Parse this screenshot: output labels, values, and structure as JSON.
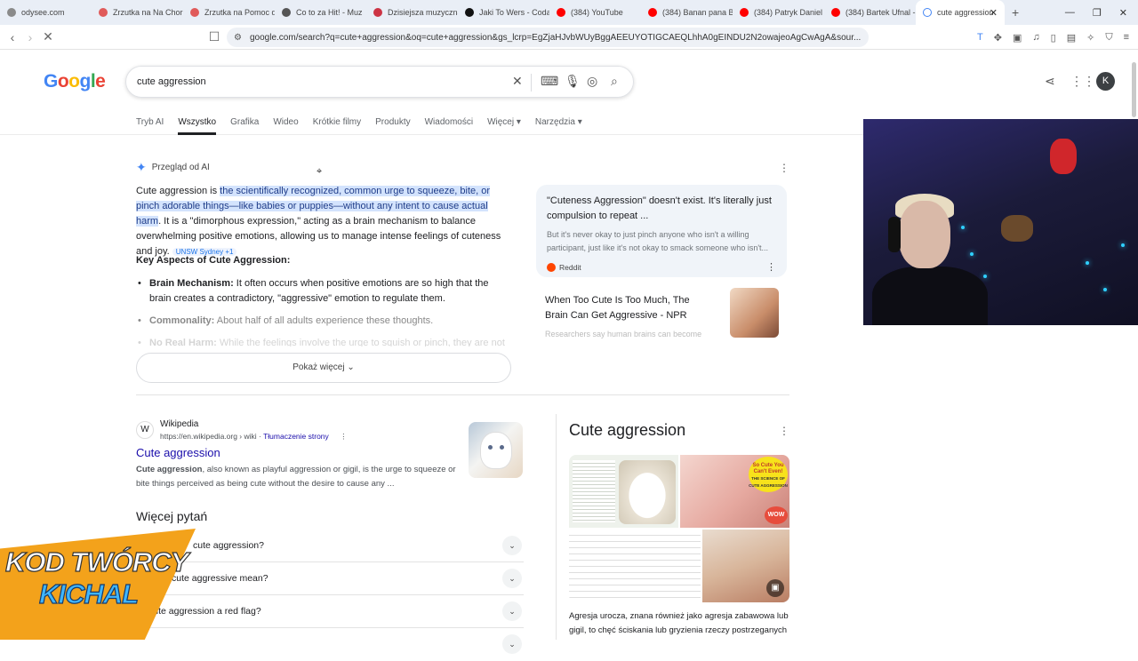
{
  "browser": {
    "tabs": [
      {
        "label": "odysee.com",
        "color": "#8a8a8a"
      },
      {
        "label": "Zrzutka na Na Chor",
        "color": "#e05a5a"
      },
      {
        "label": "Zrzutka na Pomoc d",
        "color": "#e05a5a"
      },
      {
        "label": "Co to za Hit! - Muz",
        "color": "#555555"
      },
      {
        "label": "Dzisiejsza muzyczna",
        "color": "#cc3344"
      },
      {
        "label": "Jaki To Wers - Coda",
        "color": "#111111"
      },
      {
        "label": "(384) YouTube",
        "color": "#ff0000"
      },
      {
        "label": "(384) Banan pana B",
        "color": "#ff0000"
      },
      {
        "label": "(384) Patryk Daniel",
        "color": "#ff0000"
      },
      {
        "label": "(384) Bartek Ufnal -",
        "color": "#ff0000"
      }
    ],
    "active_tab": {
      "label": "cute aggression",
      "close": "✕"
    },
    "new_tab": "+",
    "url": "google.com/search?q=cute+aggression&oq=cute+aggression&gs_lcrp=EgZjaHJvbWUyBggAEEUYOTIGCAEQLhhA0gEINDU2N2owajeoAgCwAgA&sour..."
  },
  "google": {
    "logo": "Google",
    "query": "cute aggression",
    "avatar_letter": "K",
    "tabs": [
      "Tryb AI",
      "Wszystko",
      "Grafika",
      "Wideo",
      "Krótkie filmy",
      "Produkty",
      "Wiadomości",
      "Więcej ▾",
      "Narzędzia ▾"
    ]
  },
  "ai_overview": {
    "title": "Przegląd od AI",
    "intro_a": "Cute aggression is ",
    "intro_hl": "the scientifically recognized, common urge to squeeze, bite, or pinch adorable things—like babies or puppies—without any intent to cause actual harm",
    "intro_b": ". It is a \"dimorphous expression,\" acting as a brain mechanism to balance overwhelming positive emotions, allowing us to manage intense feelings of cuteness and joy.",
    "citation": "UNSW Sydney +1",
    "heading": "Key Aspects of Cute Aggression:",
    "bullet1_bold": "Brain Mechanism:",
    "bullet1_text": " It often occurs when positive emotions are so high that the brain creates a contradictory, \"aggressive\" emotion to regulate them.",
    "bullet2_bold": "Commonality:",
    "bullet2_text": " About half of all adults experience these thoughts.",
    "bullet3_bold": "No Real Harm:",
    "bullet3_text": " While the feelings involve the urge to squish or pinch, they are not",
    "show_more": "Pokaż więcej",
    "card1_title": "\"Cuteness Aggression\" doesn't exist. It's literally just compulsion to repeat ...",
    "card1_snippet": "But it's never okay to just pinch anyone who isn't a willing participant, just like it's not okay to smack someone who isn't...",
    "card1_source": "Reddit",
    "card2_title": "When Too Cute Is Too Much, The Brain Can Get Aggressive - NPR",
    "card2_snippet": "Researchers say human brains can become overwhelmed by cute things"
  },
  "result": {
    "site": "Wikipedia",
    "url": "https://en.wikipedia.org › wiki",
    "translate": "Tłumaczenie strony",
    "title": "Cute aggression",
    "snippet_bold": "Cute aggression",
    "snippet": ", also known as playful aggression or gigil, is the urge to squeeze or bite things perceived as being cute without the desire to cause any ..."
  },
  "paa": {
    "heading": "Więcej pytań",
    "questions": [
      "cute aggression?",
      "cute aggressive mean?",
      "cute aggression a red flag?"
    ]
  },
  "knowledge_panel": {
    "title": "Cute aggression",
    "badge_line1": "So Cute You Can't Even!",
    "badge_line2": "THE SCIENCE OF CUTE AGGRESSION",
    "wow": "WOW",
    "desc": "Agresja urocza, znana również jako agresja zabawowa lub gigil, to chęć ściskania lub gryzienia rzeczy postrzeganych"
  },
  "overlay": {
    "line1": "KOD TWÓRCY",
    "line2": "KICHAL"
  }
}
